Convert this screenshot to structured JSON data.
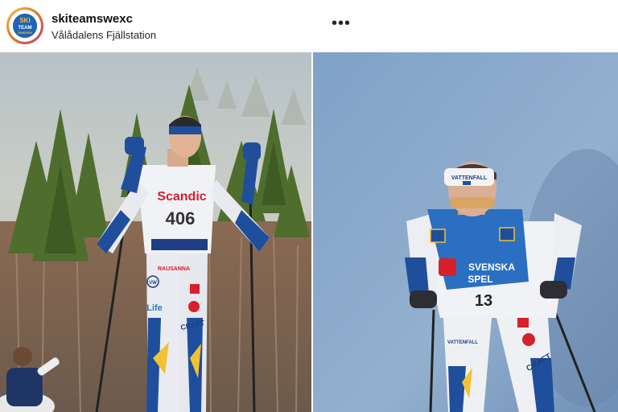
{
  "post_header": {
    "username": "skiteamswexc",
    "location": "Vålådalens Fjällstation",
    "more_icon": "more-horizontal-icon",
    "more_glyph": "•••"
  },
  "avatar": {
    "logo_lines": [
      "SKI",
      "TEAM",
      "SWEDEN"
    ]
  },
  "photos": {
    "left": {
      "bib_number": "406",
      "sponsor_chest": "Scandic",
      "sponsor_belt": "RAUSANNA",
      "leg_brands": [
        "VW",
        "Life",
        "CRAFT"
      ]
    },
    "right": {
      "headband_text": "VATTENFALL",
      "bib_sponsor_line1": "SVENSKA",
      "bib_sponsor_line2": "SPEL",
      "bib_number": "13",
      "leg_brands": [
        "VATTENFALL",
        "CRAFT"
      ]
    }
  },
  "colors": {
    "swedish_blue": "#1f4e9c",
    "swedish_yellow": "#f2c230",
    "scandic_red": "#d6202a"
  }
}
